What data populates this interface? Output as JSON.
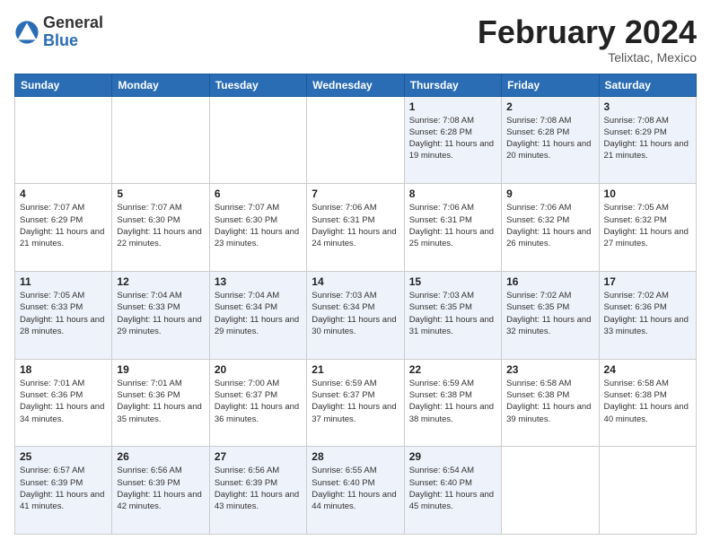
{
  "logo": {
    "general": "General",
    "blue": "Blue"
  },
  "header": {
    "month_year": "February 2024",
    "location": "Telixtac, Mexico"
  },
  "weekdays": [
    "Sunday",
    "Monday",
    "Tuesday",
    "Wednesday",
    "Thursday",
    "Friday",
    "Saturday"
  ],
  "weeks": [
    [
      {
        "day": "",
        "sunrise": "",
        "sunset": "",
        "daylight": ""
      },
      {
        "day": "",
        "sunrise": "",
        "sunset": "",
        "daylight": ""
      },
      {
        "day": "",
        "sunrise": "",
        "sunset": "",
        "daylight": ""
      },
      {
        "day": "",
        "sunrise": "",
        "sunset": "",
        "daylight": ""
      },
      {
        "day": "1",
        "sunrise": "7:08 AM",
        "sunset": "6:28 PM",
        "daylight": "11 hours and 19 minutes."
      },
      {
        "day": "2",
        "sunrise": "7:08 AM",
        "sunset": "6:28 PM",
        "daylight": "11 hours and 20 minutes."
      },
      {
        "day": "3",
        "sunrise": "7:08 AM",
        "sunset": "6:29 PM",
        "daylight": "11 hours and 21 minutes."
      }
    ],
    [
      {
        "day": "4",
        "sunrise": "7:07 AM",
        "sunset": "6:29 PM",
        "daylight": "11 hours and 21 minutes."
      },
      {
        "day": "5",
        "sunrise": "7:07 AM",
        "sunset": "6:30 PM",
        "daylight": "11 hours and 22 minutes."
      },
      {
        "day": "6",
        "sunrise": "7:07 AM",
        "sunset": "6:30 PM",
        "daylight": "11 hours and 23 minutes."
      },
      {
        "day": "7",
        "sunrise": "7:06 AM",
        "sunset": "6:31 PM",
        "daylight": "11 hours and 24 minutes."
      },
      {
        "day": "8",
        "sunrise": "7:06 AM",
        "sunset": "6:31 PM",
        "daylight": "11 hours and 25 minutes."
      },
      {
        "day": "9",
        "sunrise": "7:06 AM",
        "sunset": "6:32 PM",
        "daylight": "11 hours and 26 minutes."
      },
      {
        "day": "10",
        "sunrise": "7:05 AM",
        "sunset": "6:32 PM",
        "daylight": "11 hours and 27 minutes."
      }
    ],
    [
      {
        "day": "11",
        "sunrise": "7:05 AM",
        "sunset": "6:33 PM",
        "daylight": "11 hours and 28 minutes."
      },
      {
        "day": "12",
        "sunrise": "7:04 AM",
        "sunset": "6:33 PM",
        "daylight": "11 hours and 29 minutes."
      },
      {
        "day": "13",
        "sunrise": "7:04 AM",
        "sunset": "6:34 PM",
        "daylight": "11 hours and 29 minutes."
      },
      {
        "day": "14",
        "sunrise": "7:03 AM",
        "sunset": "6:34 PM",
        "daylight": "11 hours and 30 minutes."
      },
      {
        "day": "15",
        "sunrise": "7:03 AM",
        "sunset": "6:35 PM",
        "daylight": "11 hours and 31 minutes."
      },
      {
        "day": "16",
        "sunrise": "7:02 AM",
        "sunset": "6:35 PM",
        "daylight": "11 hours and 32 minutes."
      },
      {
        "day": "17",
        "sunrise": "7:02 AM",
        "sunset": "6:36 PM",
        "daylight": "11 hours and 33 minutes."
      }
    ],
    [
      {
        "day": "18",
        "sunrise": "7:01 AM",
        "sunset": "6:36 PM",
        "daylight": "11 hours and 34 minutes."
      },
      {
        "day": "19",
        "sunrise": "7:01 AM",
        "sunset": "6:36 PM",
        "daylight": "11 hours and 35 minutes."
      },
      {
        "day": "20",
        "sunrise": "7:00 AM",
        "sunset": "6:37 PM",
        "daylight": "11 hours and 36 minutes."
      },
      {
        "day": "21",
        "sunrise": "6:59 AM",
        "sunset": "6:37 PM",
        "daylight": "11 hours and 37 minutes."
      },
      {
        "day": "22",
        "sunrise": "6:59 AM",
        "sunset": "6:38 PM",
        "daylight": "11 hours and 38 minutes."
      },
      {
        "day": "23",
        "sunrise": "6:58 AM",
        "sunset": "6:38 PM",
        "daylight": "11 hours and 39 minutes."
      },
      {
        "day": "24",
        "sunrise": "6:58 AM",
        "sunset": "6:38 PM",
        "daylight": "11 hours and 40 minutes."
      }
    ],
    [
      {
        "day": "25",
        "sunrise": "6:57 AM",
        "sunset": "6:39 PM",
        "daylight": "11 hours and 41 minutes."
      },
      {
        "day": "26",
        "sunrise": "6:56 AM",
        "sunset": "6:39 PM",
        "daylight": "11 hours and 42 minutes."
      },
      {
        "day": "27",
        "sunrise": "6:56 AM",
        "sunset": "6:39 PM",
        "daylight": "11 hours and 43 minutes."
      },
      {
        "day": "28",
        "sunrise": "6:55 AM",
        "sunset": "6:40 PM",
        "daylight": "11 hours and 44 minutes."
      },
      {
        "day": "29",
        "sunrise": "6:54 AM",
        "sunset": "6:40 PM",
        "daylight": "11 hours and 45 minutes."
      },
      {
        "day": "",
        "sunrise": "",
        "sunset": "",
        "daylight": ""
      },
      {
        "day": "",
        "sunrise": "",
        "sunset": "",
        "daylight": ""
      }
    ]
  ]
}
